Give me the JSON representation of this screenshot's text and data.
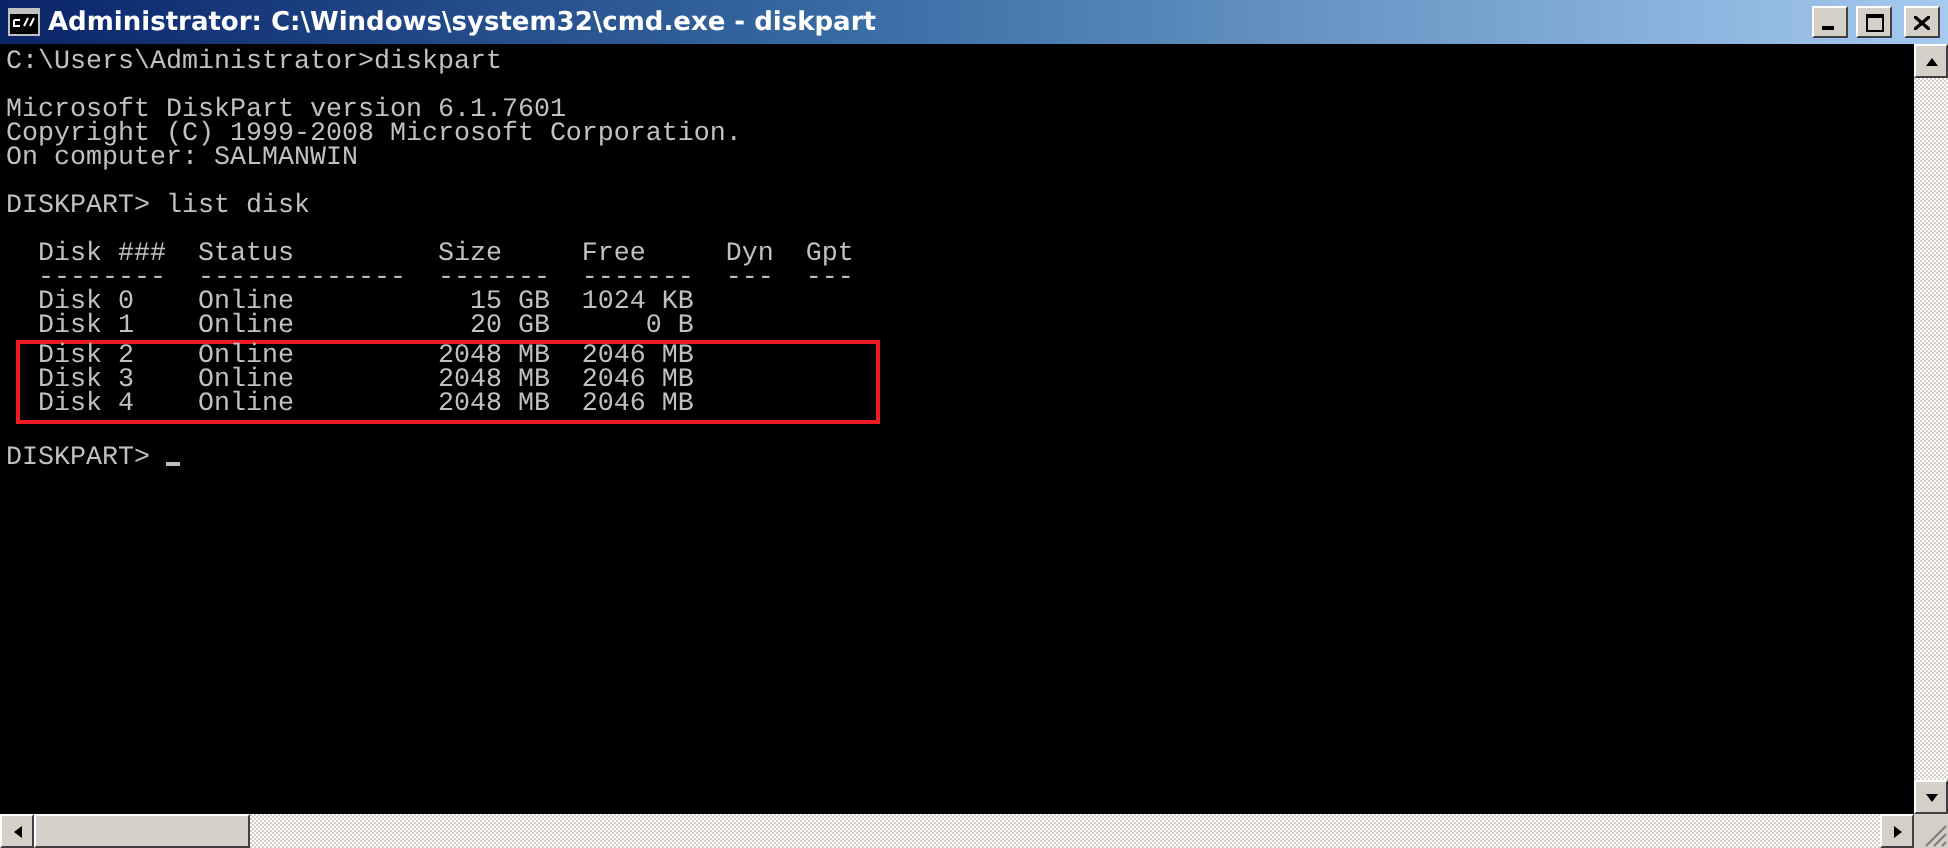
{
  "window": {
    "title": "Administrator: C:\\Windows\\system32\\cmd.exe - diskpart"
  },
  "console": {
    "lines": [
      {
        "kind": "text",
        "text": "C:\\Users\\Administrator>diskpart",
        "highlighted": false
      },
      {
        "kind": "blank"
      },
      {
        "kind": "text",
        "text": "Microsoft DiskPart version 6.1.7601",
        "highlighted": false
      },
      {
        "kind": "text",
        "text": "Copyright (C) 1999-2008 Microsoft Corporation.",
        "highlighted": false
      },
      {
        "kind": "text",
        "text": "On computer: SALMANWIN",
        "highlighted": false
      },
      {
        "kind": "blank"
      },
      {
        "kind": "text",
        "text": "DISKPART> list disk",
        "highlighted": false
      },
      {
        "kind": "blank"
      },
      {
        "kind": "text",
        "text": "  Disk ###  Status         Size     Free     Dyn  Gpt",
        "highlighted": false
      },
      {
        "kind": "text",
        "text": "  --------  -------------  -------  -------  ---  ---",
        "highlighted": false
      },
      {
        "kind": "text",
        "text": "  Disk 0    Online           15 GB  1024 KB",
        "highlighted": false
      },
      {
        "kind": "text",
        "text": "  Disk 1    Online           20 GB      0 B",
        "highlighted": false
      },
      {
        "kind": "text",
        "text": "  Disk 2    Online         2048 MB  2046 MB",
        "highlighted": true
      },
      {
        "kind": "text",
        "text": "  Disk 3    Online         2048 MB  2046 MB",
        "highlighted": true
      },
      {
        "kind": "text",
        "text": "  Disk 4    Online         2048 MB  2046 MB",
        "highlighted": true
      },
      {
        "kind": "blank"
      },
      {
        "kind": "prompt",
        "text": "DISKPART> ",
        "cursor": true
      }
    ]
  }
}
